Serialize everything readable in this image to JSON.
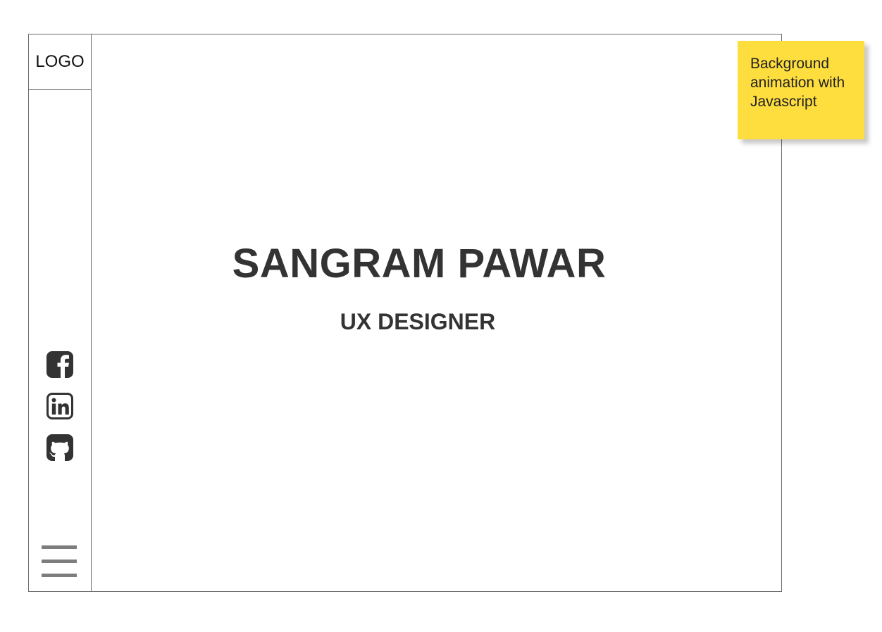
{
  "sidebar": {
    "logo_text": "LOGO",
    "social_links": [
      {
        "icon": "facebook-icon"
      },
      {
        "icon": "linkedin-icon"
      },
      {
        "icon": "github-icon"
      }
    ],
    "menu_icon": "hamburger-menu-icon"
  },
  "hero": {
    "name": "SANGRAM PAWAR",
    "role": "UX DESIGNER"
  },
  "annotation": {
    "note_text": "Background\nanimation with\nJavascript",
    "color": "#fede3f"
  },
  "colors": {
    "border": "#6b6b6b",
    "text": "#333333",
    "icon": "#333333",
    "menu_lines": "#7d7d7d"
  }
}
